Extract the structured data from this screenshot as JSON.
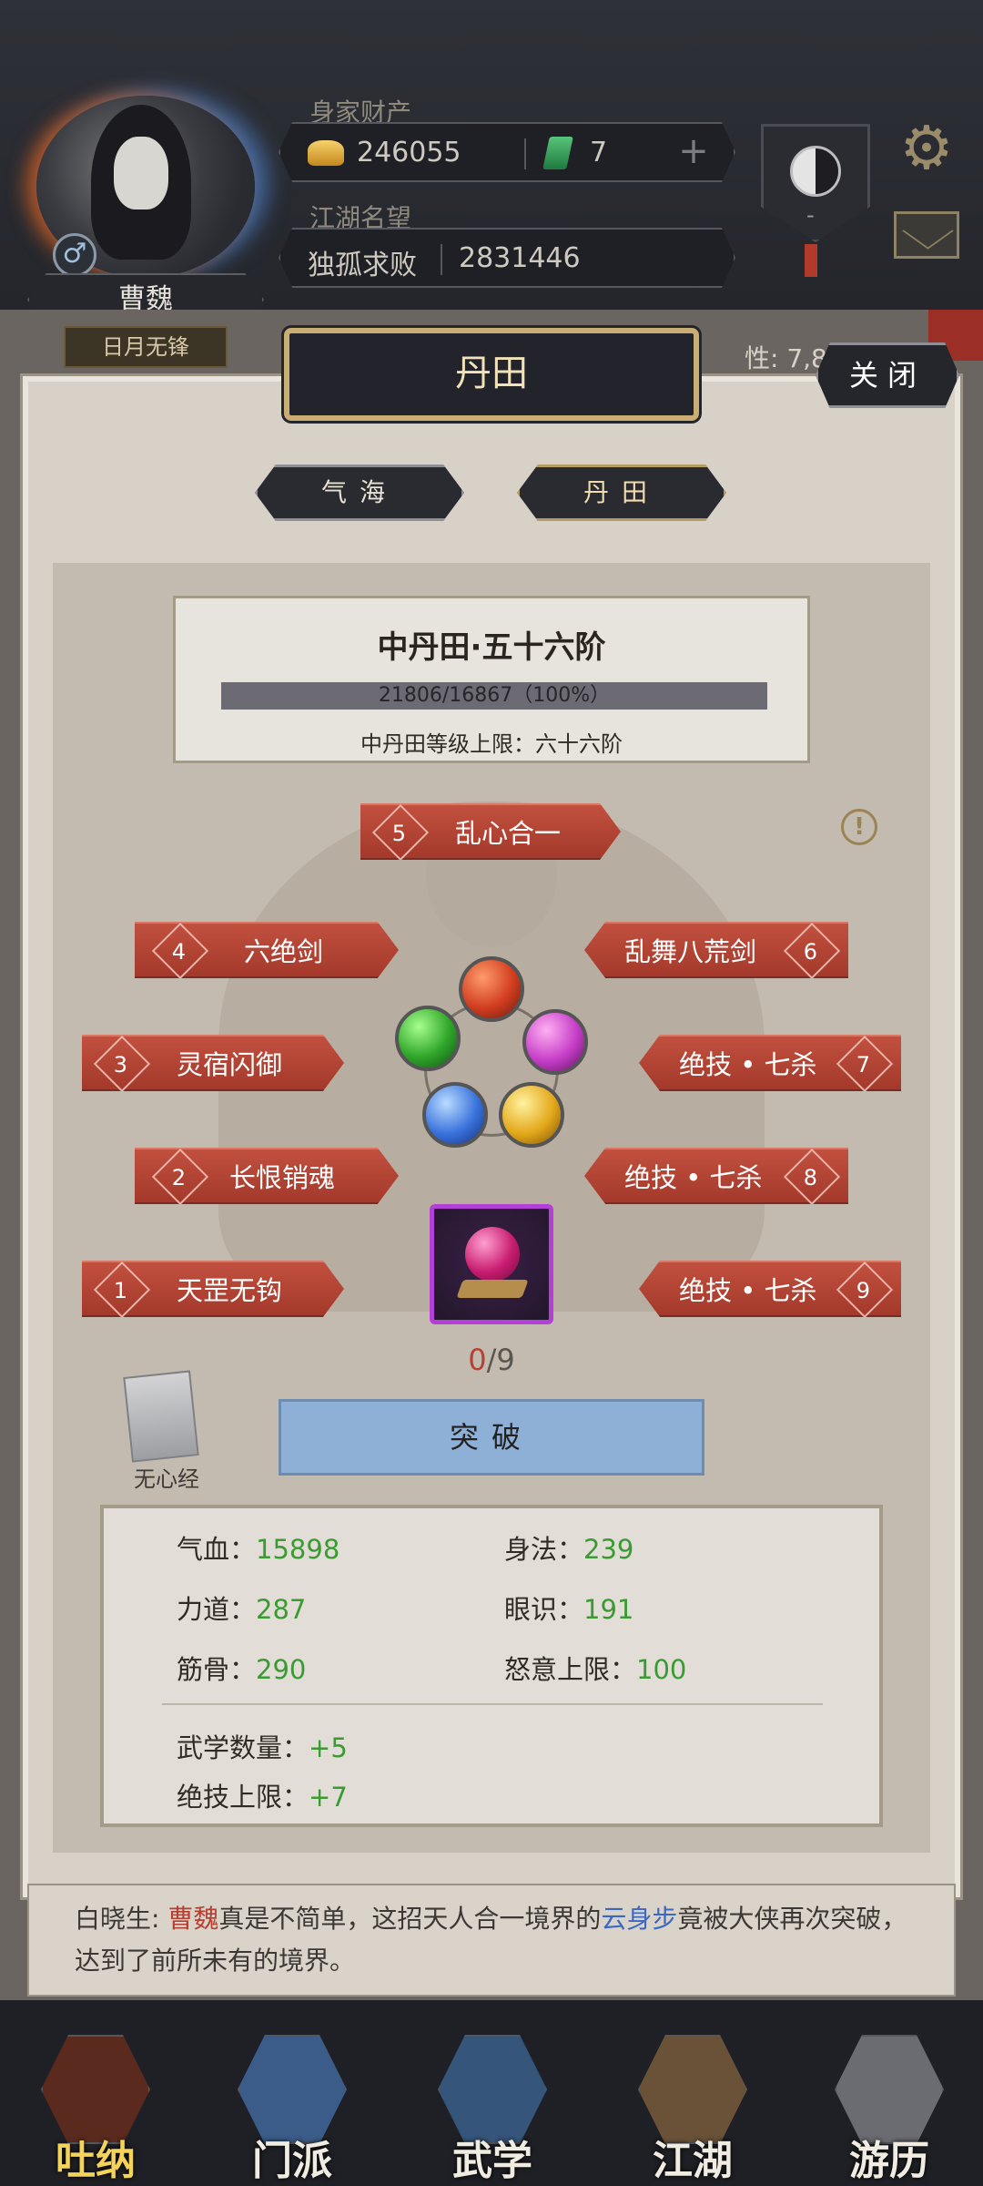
{
  "header": {
    "player_name": "曹魏",
    "player_title": "日月无锋",
    "gender_symbol": "♂",
    "wealth_label": "身家财产",
    "gold": "246055",
    "jade": "7",
    "plus": "+",
    "fame_label": "江湖名望",
    "fame_title": "独孤求败",
    "fame_value": "2831446",
    "taiji_value": "-",
    "gear_icon": "⚙",
    "bg_stat_text": "性: 7,801"
  },
  "modal": {
    "title": "丹田",
    "close_label": "关闭",
    "tabs": [
      {
        "label": "气海",
        "active": false
      },
      {
        "label": "丹田",
        "active": true
      }
    ],
    "info": {
      "title": "中丹田·五十六阶",
      "progress_text": "21806/16867（100%）",
      "progress_ratio": 1.0,
      "limit_text": "中丹田等级上限：六十六阶"
    },
    "warn_icon": "!",
    "skills_left": [
      {
        "num": "5",
        "name": "乱心合一"
      },
      {
        "num": "4",
        "name": "六绝剑"
      },
      {
        "num": "3",
        "name": "灵宿闪御"
      },
      {
        "num": "2",
        "name": "长恨销魂"
      },
      {
        "num": "1",
        "name": "天罡无钩"
      }
    ],
    "skills_right": [
      {
        "num": "6",
        "name": "乱舞八荒剑"
      },
      {
        "num": "7",
        "name": "绝技 • 七杀"
      },
      {
        "num": "8",
        "name": "绝技 • 七杀"
      },
      {
        "num": "9",
        "name": "绝技 • 七杀"
      }
    ],
    "count_current": "0",
    "count_total": "/9",
    "book_label": "无心经",
    "breakthrough_label": "突破",
    "stats": {
      "hp_label": "气血：",
      "hp": "15898",
      "agility_label": "身法：",
      "agility": "239",
      "strength_label": "力道：",
      "strength": "287",
      "insight_label": "眼识：",
      "insight": "191",
      "bone_label": "筋骨：",
      "bone": "290",
      "rage_label": "怒意上限：",
      "rage": "100",
      "martial_count_label": "武学数量：",
      "martial_count": "+5",
      "ult_limit_label": "绝技上限：",
      "ult_limit": "+7"
    }
  },
  "chat": {
    "speaker": "白晓生",
    "name": "曹魏",
    "mid": "真是不简单，这招天人合一境界的",
    "skill": "云身步",
    "tail": "竟被大侠再次突破，达到了前所未有的境界。"
  },
  "nav": [
    {
      "label": "吐纳",
      "active": true
    },
    {
      "label": "门派",
      "active": false
    },
    {
      "label": "武学",
      "active": false
    },
    {
      "label": "江湖",
      "active": false
    },
    {
      "label": "游历",
      "active": false
    }
  ]
}
